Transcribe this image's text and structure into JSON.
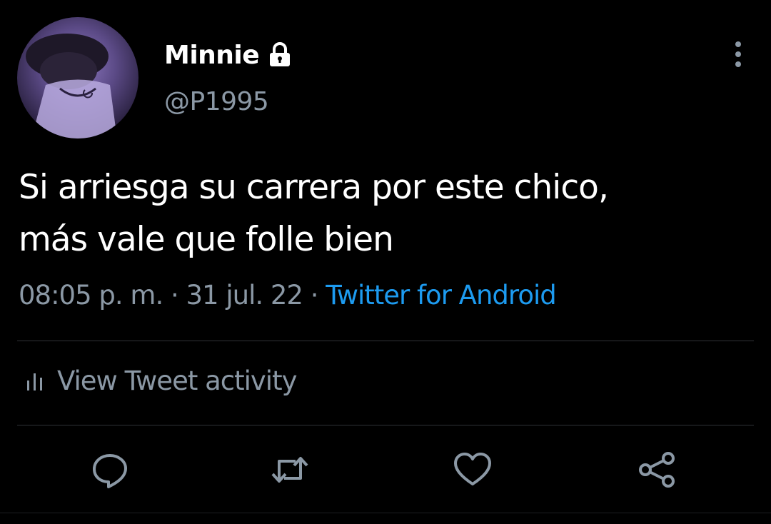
{
  "user": {
    "display_name": "Minnie",
    "handle": "@P1995",
    "protected_icon": "lock-icon",
    "avatar": "profile-photo"
  },
  "tweet": {
    "text_lines": [
      "Si arriesga su carrera por este chico,",
      "más vale que folle bien"
    ],
    "time": "08:05 p. m.",
    "separator": "·",
    "date": "31 jul. 22",
    "source": "Twitter for Android"
  },
  "activity": {
    "icon": "bar-chart-icon",
    "label": "View Tweet activity"
  },
  "actions": [
    {
      "name": "reply",
      "icon": "comment-bubble-icon"
    },
    {
      "name": "retweet",
      "icon": "retweet-arrows-icon"
    },
    {
      "name": "like",
      "icon": "heart-icon"
    },
    {
      "name": "share",
      "icon": "share-icon"
    }
  ],
  "menu_icon": "more-vertical-icon",
  "colors": {
    "background": "#000000",
    "primary_text": "#ffffff",
    "secondary_text": "#8b98a5",
    "link": "#1d9bf0",
    "divider": "#2f3336"
  }
}
